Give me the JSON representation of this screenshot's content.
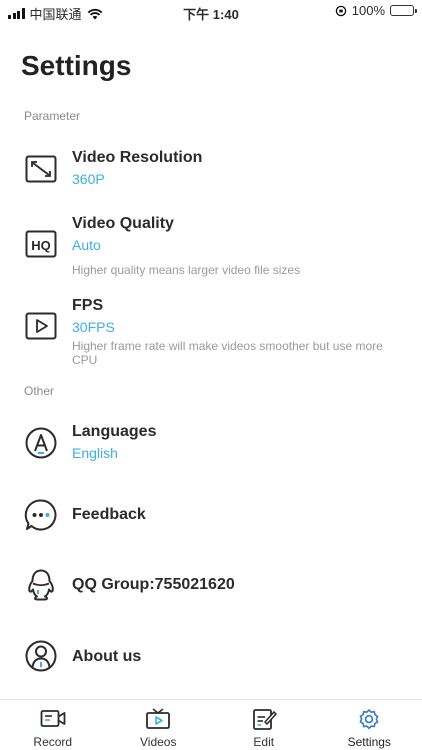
{
  "status_bar": {
    "carrier": "中国联通",
    "time": "下午 1:40",
    "battery": "100%"
  },
  "page_title": "Settings",
  "sections": {
    "parameter": "Parameter",
    "other": "Other"
  },
  "rows": {
    "resolution": {
      "title": "Video Resolution",
      "value": "360P",
      "icon": "resolution-icon"
    },
    "quality": {
      "title": "Video Quality",
      "value": "Auto",
      "desc": "Higher quality means larger video file sizes",
      "icon": "hq-icon"
    },
    "fps": {
      "title": "FPS",
      "value": "30FPS",
      "desc": "Higher frame rate will make videos smoother but use more CPU",
      "icon": "play-icon"
    },
    "languages": {
      "title": "Languages",
      "value": "English",
      "icon": "language-icon"
    },
    "feedback": {
      "title": "Feedback",
      "icon": "chat-bubble-icon"
    },
    "qq": {
      "title": "QQ Group:755021620",
      "icon": "qq-penguin-icon"
    },
    "about": {
      "title": "About us",
      "icon": "user-info-icon"
    }
  },
  "tabs": [
    {
      "label": "Record",
      "icon": "record-icon"
    },
    {
      "label": "Videos",
      "icon": "tv-play-icon"
    },
    {
      "label": "Edit",
      "icon": "edit-icon"
    },
    {
      "label": "Settings",
      "icon": "gear-icon",
      "active": true
    }
  ],
  "colors": {
    "accent": "#3bb0e0",
    "text": "#2b2b2b",
    "muted": "#9a9a9a",
    "battery": "#4cd964"
  }
}
